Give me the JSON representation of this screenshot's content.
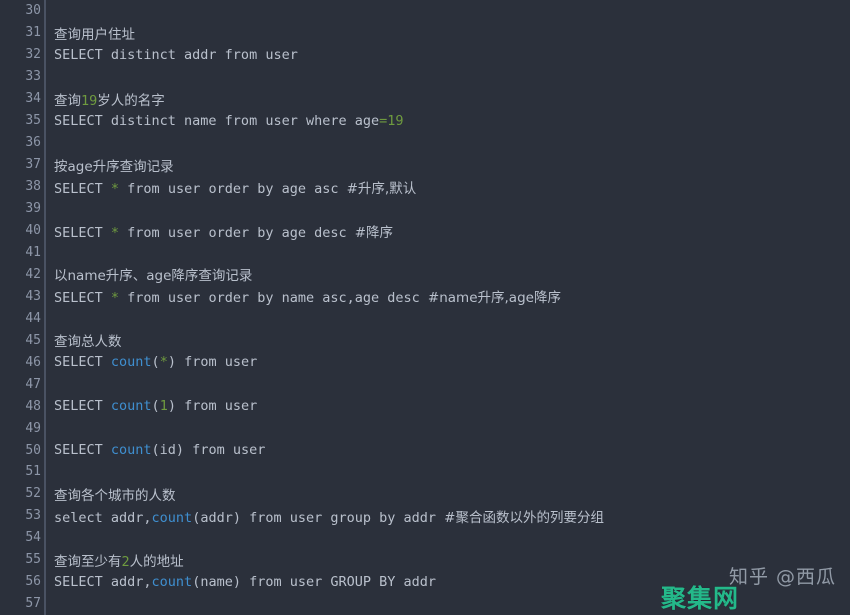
{
  "editor": {
    "theme_background": "#2b303b",
    "gutter_text_color": "#8d96a8",
    "default_text_color": "#b9c0cc",
    "number_color": "#6f9b3f",
    "function_color": "#3f8fd0",
    "first_line_number": 30,
    "last_line_number": 57
  },
  "watermarks": {
    "zhihu": "知乎 @西瓜",
    "juji": "聚集网"
  },
  "lines": [
    {
      "num": "30",
      "tokens": []
    },
    {
      "num": "31",
      "tokens": [
        {
          "t": "查询用户住址",
          "c": "tok-comment cn"
        }
      ]
    },
    {
      "num": "32",
      "tokens": [
        {
          "t": "SELECT distinct addr from user",
          "c": "tok-plain"
        }
      ]
    },
    {
      "num": "33",
      "tokens": []
    },
    {
      "num": "34",
      "tokens": [
        {
          "t": "查询",
          "c": "tok-comment cn"
        },
        {
          "t": "19",
          "c": "tok-num"
        },
        {
          "t": "岁人的名字",
          "c": "tok-comment cn"
        }
      ]
    },
    {
      "num": "35",
      "tokens": [
        {
          "t": "SELECT distinct name from user where age",
          "c": "tok-plain"
        },
        {
          "t": "=",
          "c": "tok-op"
        },
        {
          "t": "19",
          "c": "tok-num"
        }
      ]
    },
    {
      "num": "36",
      "tokens": []
    },
    {
      "num": "37",
      "tokens": [
        {
          "t": "按age升序查询记录",
          "c": "tok-comment cn"
        }
      ]
    },
    {
      "num": "38",
      "tokens": [
        {
          "t": "SELECT ",
          "c": "tok-plain"
        },
        {
          "t": "*",
          "c": "tok-star"
        },
        {
          "t": " from user order by age asc ",
          "c": "tok-plain"
        },
        {
          "t": "#升序,默认",
          "c": "tok-comment cn"
        }
      ]
    },
    {
      "num": "39",
      "tokens": []
    },
    {
      "num": "40",
      "tokens": [
        {
          "t": "SELECT ",
          "c": "tok-plain"
        },
        {
          "t": "*",
          "c": "tok-star"
        },
        {
          "t": " from user order by age desc ",
          "c": "tok-plain"
        },
        {
          "t": "#降序",
          "c": "tok-comment cn"
        }
      ]
    },
    {
      "num": "41",
      "tokens": []
    },
    {
      "num": "42",
      "tokens": [
        {
          "t": "以name升序、age降序查询记录",
          "c": "tok-comment cn"
        }
      ]
    },
    {
      "num": "43",
      "tokens": [
        {
          "t": "SELECT ",
          "c": "tok-plain"
        },
        {
          "t": "*",
          "c": "tok-star"
        },
        {
          "t": " from user order by name asc,age desc ",
          "c": "tok-plain"
        },
        {
          "t": "#name升序,age降序",
          "c": "tok-comment cn"
        }
      ]
    },
    {
      "num": "44",
      "tokens": []
    },
    {
      "num": "45",
      "tokens": [
        {
          "t": "查询总人数",
          "c": "tok-comment cn"
        }
      ]
    },
    {
      "num": "46",
      "tokens": [
        {
          "t": "SELECT ",
          "c": "tok-plain"
        },
        {
          "t": "count",
          "c": "tok-func"
        },
        {
          "t": "(",
          "c": "tok-punct"
        },
        {
          "t": "*",
          "c": "tok-star"
        },
        {
          "t": ") from user",
          "c": "tok-plain"
        }
      ]
    },
    {
      "num": "47",
      "tokens": []
    },
    {
      "num": "48",
      "tokens": [
        {
          "t": "SELECT ",
          "c": "tok-plain"
        },
        {
          "t": "count",
          "c": "tok-func"
        },
        {
          "t": "(",
          "c": "tok-punct"
        },
        {
          "t": "1",
          "c": "tok-num"
        },
        {
          "t": ") from user",
          "c": "tok-plain"
        }
      ]
    },
    {
      "num": "49",
      "tokens": []
    },
    {
      "num": "50",
      "tokens": [
        {
          "t": "SELECT ",
          "c": "tok-plain"
        },
        {
          "t": "count",
          "c": "tok-func"
        },
        {
          "t": "(id) from user",
          "c": "tok-plain"
        }
      ]
    },
    {
      "num": "51",
      "tokens": []
    },
    {
      "num": "52",
      "tokens": [
        {
          "t": "查询各个城市的人数",
          "c": "tok-comment cn"
        }
      ]
    },
    {
      "num": "53",
      "tokens": [
        {
          "t": "select addr,",
          "c": "tok-plain"
        },
        {
          "t": "count",
          "c": "tok-func"
        },
        {
          "t": "(addr) from user group by addr ",
          "c": "tok-plain"
        },
        {
          "t": "#聚合函数以外的列要分组",
          "c": "tok-comment cn"
        }
      ]
    },
    {
      "num": "54",
      "tokens": []
    },
    {
      "num": "55",
      "tokens": [
        {
          "t": "查询至少有",
          "c": "tok-comment cn"
        },
        {
          "t": "2",
          "c": "tok-num"
        },
        {
          "t": "人的地址",
          "c": "tok-comment cn"
        }
      ]
    },
    {
      "num": "56",
      "tokens": [
        {
          "t": "SELECT addr,",
          "c": "tok-plain"
        },
        {
          "t": "count",
          "c": "tok-func"
        },
        {
          "t": "(name) from user GROUP BY addr",
          "c": "tok-plain"
        }
      ]
    },
    {
      "num": "57",
      "tokens": []
    }
  ]
}
